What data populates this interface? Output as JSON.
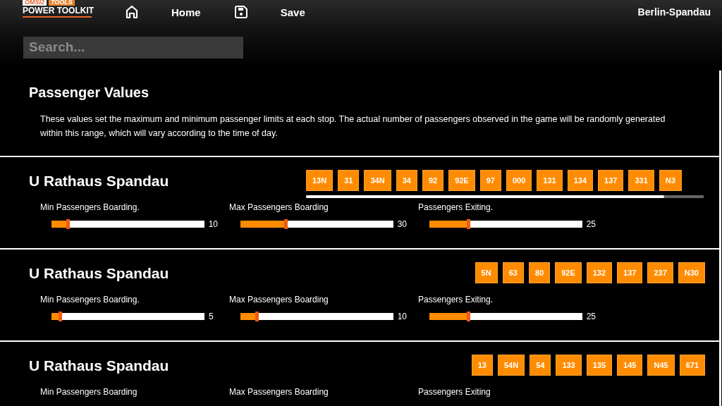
{
  "header": {
    "logo_top": [
      "OMSI2",
      "TOOLS"
    ],
    "logo": "POWER TOOLKIT",
    "nav": [
      {
        "label": "Home"
      },
      {
        "label": "Save"
      }
    ],
    "location": "Berlin-Spandau"
  },
  "search": {
    "placeholder": "Search..."
  },
  "intro": {
    "title": "Passenger Values",
    "text": "These values set the maximum and minimum passenger limits at each stop. The actual number of passengers observed in the game will be randomly generated within this range, which will vary according to the time of day."
  },
  "stops": [
    {
      "name": "U Rathaus Spandau",
      "routes": [
        "13N",
        "31",
        "34N",
        "34",
        "92",
        "92E",
        "97",
        "000",
        "131",
        "134",
        "137",
        "331",
        "N3"
      ],
      "scrollable": true,
      "sliders": [
        {
          "label": "Min Passengers Boarding.",
          "level": 0.11,
          "reading": "10"
        },
        {
          "label": "Max Passengers Boarding",
          "level": 0.3,
          "reading": "30"
        },
        {
          "label": "Passengers Exiting.",
          "level": 0.26,
          "reading": "25"
        }
      ]
    },
    {
      "name": "U Rathaus Spandau",
      "routes": [
        "5N",
        "63",
        "80",
        "92E",
        "132",
        "137",
        "237",
        "N30"
      ],
      "scrollable": false,
      "sliders": [
        {
          "label": "Min Passengers Boarding.",
          "level": 0.06,
          "reading": "5"
        },
        {
          "label": "Max Passengers Boarding",
          "level": 0.11,
          "reading": "10"
        },
        {
          "label": "Passengers Exiting.",
          "level": 0.26,
          "reading": "25"
        }
      ]
    },
    {
      "name": "U Rathaus Spandau",
      "routes": [
        "13",
        "54N",
        "54",
        "133",
        "135",
        "145",
        "N45",
        "671"
      ],
      "scrollable": false,
      "sliders": [
        {
          "label": "Min Passengers Boarding"
        },
        {
          "label": "Max Passengers Boarding"
        },
        {
          "label": "Passengers Exiting"
        }
      ]
    }
  ]
}
